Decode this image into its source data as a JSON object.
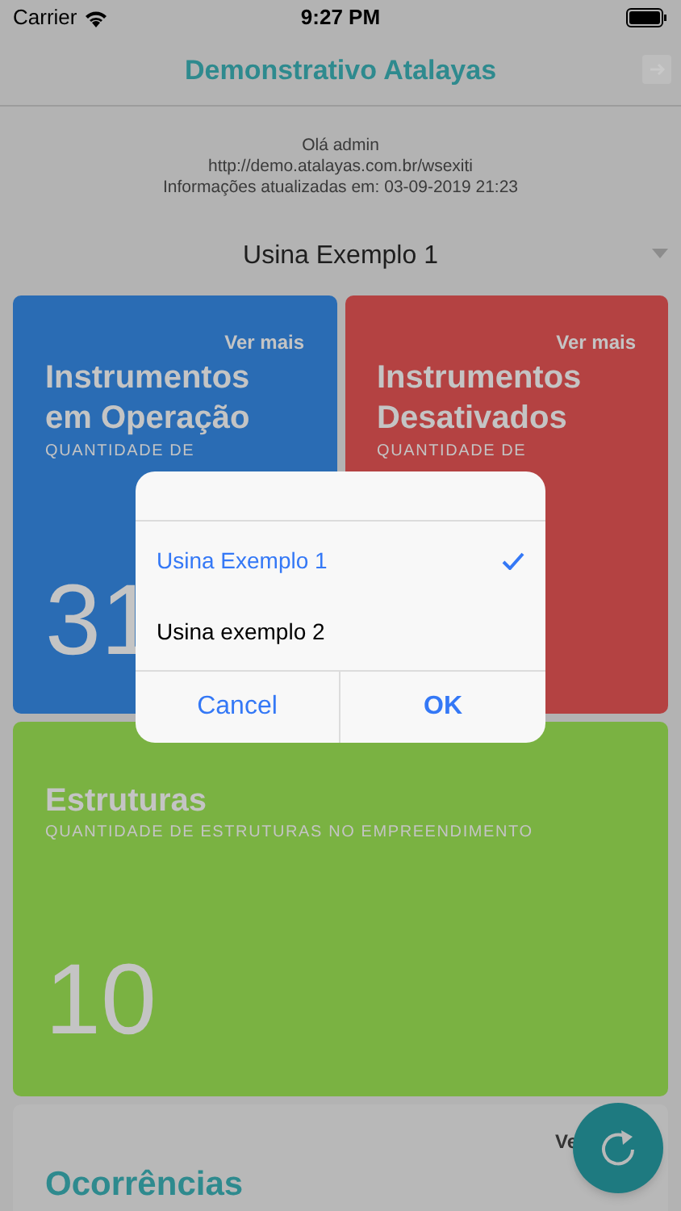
{
  "status_bar": {
    "carrier": "Carrier",
    "time": "9:27 PM"
  },
  "header": {
    "title": "Demonstrativo Atalayas"
  },
  "info": {
    "greeting": "Olá admin",
    "url": "http://demo.atalayas.com.br/wsexiti",
    "updated": "Informações atualizadas em: 03-09-2019 21:23"
  },
  "plant_select": {
    "value": "Usina Exemplo 1"
  },
  "cards": [
    {
      "color": "#2a6cb4",
      "link": "Ver mais",
      "title": "Instrumentos em Operação",
      "subtitle": "QUANTIDADE DE",
      "count": "31"
    },
    {
      "color": "#b44242",
      "link": "Ver mais",
      "title": "Instrumentos Desativados",
      "subtitle": "QUANTIDADE DE"
    }
  ],
  "structures_card": {
    "color": "#7ab242",
    "title": "Estruturas",
    "subtitle": "QUANTIDADE DE ESTRUTURAS NO EMPREENDIMENTO",
    "count": "10"
  },
  "occurrences_card": {
    "link": "Ve",
    "title": "Ocorrências"
  },
  "dialog": {
    "options": [
      {
        "label": "Usina Exemplo 1",
        "selected": true
      },
      {
        "label": "Usina exemplo 2",
        "selected": false
      }
    ],
    "cancel": "Cancel",
    "ok": "OK"
  }
}
